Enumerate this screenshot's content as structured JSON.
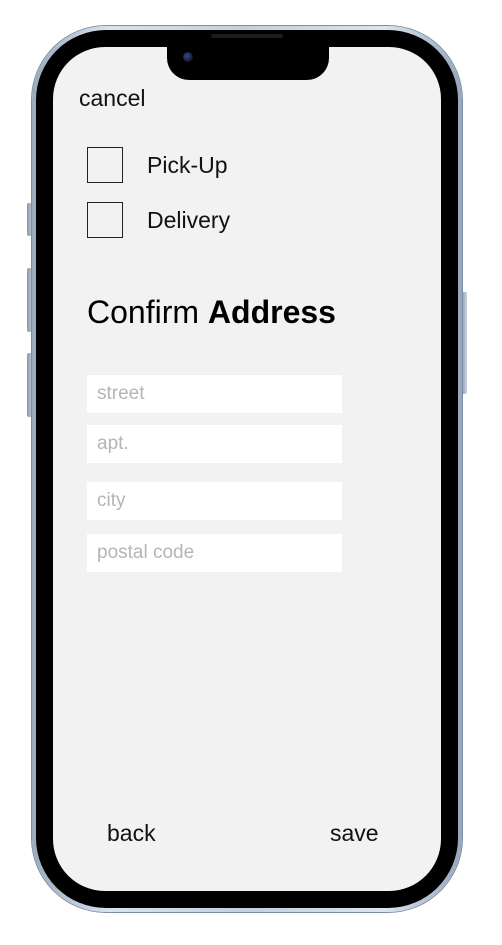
{
  "top_bar": {
    "cancel_label": "cancel"
  },
  "options": [
    {
      "label": "Pick-Up",
      "checked": false
    },
    {
      "label": "Delivery",
      "checked": false
    }
  ],
  "heading": {
    "regular": "Confirm",
    "bold": "Address"
  },
  "form": {
    "street_placeholder": "street",
    "apt_placeholder": "apt.",
    "city_placeholder": "city",
    "postal_code_placeholder": "postal code"
  },
  "footer": {
    "back_label": "back",
    "save_label": "save"
  }
}
